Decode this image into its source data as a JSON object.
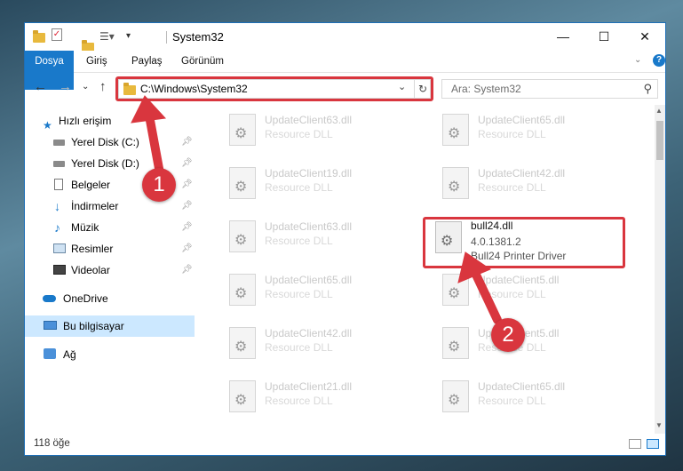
{
  "window": {
    "title": "System32",
    "controls": {
      "minimize": "—",
      "maximize": "☐",
      "close": "✕"
    }
  },
  "ribbon": {
    "tabs": [
      "Dosya",
      "Giriş",
      "Paylaş",
      "Görünüm"
    ],
    "help": "?"
  },
  "nav": {
    "address": "C:\\Windows\\System32",
    "search_placeholder": "Ara: System32"
  },
  "sidebar": {
    "items": [
      {
        "label": "Hızlı erişim",
        "icon": "star-icon",
        "pinned": false
      },
      {
        "label": "Yerel Disk (C:)",
        "icon": "drive-icon",
        "pinned": true
      },
      {
        "label": "Yerel Disk (D:)",
        "icon": "drive-icon",
        "pinned": true
      },
      {
        "label": "Belgeler",
        "icon": "document-icon",
        "pinned": true
      },
      {
        "label": "İndirmeler",
        "icon": "download-icon",
        "pinned": true
      },
      {
        "label": "Müzik",
        "icon": "music-icon",
        "pinned": true
      },
      {
        "label": "Resimler",
        "icon": "picture-icon",
        "pinned": true
      },
      {
        "label": "Videolar",
        "icon": "video-icon",
        "pinned": true
      },
      {
        "label": "OneDrive",
        "icon": "cloud-icon",
        "pinned": false
      },
      {
        "label": "Bu bilgisayar",
        "icon": "computer-icon",
        "pinned": false,
        "selected": true
      },
      {
        "label": "Ağ",
        "icon": "network-icon",
        "pinned": false
      }
    ]
  },
  "files": [
    {
      "name": "UpdateClient63.dll",
      "desc": "Resource DLL"
    },
    {
      "name": "UpdateClient65.dll",
      "desc": "Resource DLL"
    },
    {
      "name": "UpdateClient19.dll",
      "desc": "Resource DLL"
    },
    {
      "name": "UpdateClient42.dll",
      "desc": "Resource DLL"
    },
    {
      "name": "UpdateClient63.dll",
      "desc": "Resource DLL"
    },
    {
      "name": "bull24.dll",
      "version": "4.0.1381.2",
      "desc": "Bull24 Printer Driver"
    },
    {
      "name": "UpdateClient65.dll",
      "desc": "Resource DLL"
    },
    {
      "name": "UpdateClient5.dll",
      "desc": "Resource DLL"
    },
    {
      "name": "UpdateClient42.dll",
      "desc": "Resource DLL"
    },
    {
      "name": "UpdateClient5.dll",
      "desc": "Resource DLL"
    },
    {
      "name": "UpdateClient21.dll",
      "desc": "Resource DLL"
    },
    {
      "name": "UpdateClient65.dll",
      "desc": "Resource DLL"
    }
  ],
  "status": {
    "count": "118 öğe"
  },
  "annotations": {
    "step1": "1",
    "step2": "2"
  },
  "colors": {
    "accent": "#1979ca",
    "highlight": "#d9363e"
  }
}
